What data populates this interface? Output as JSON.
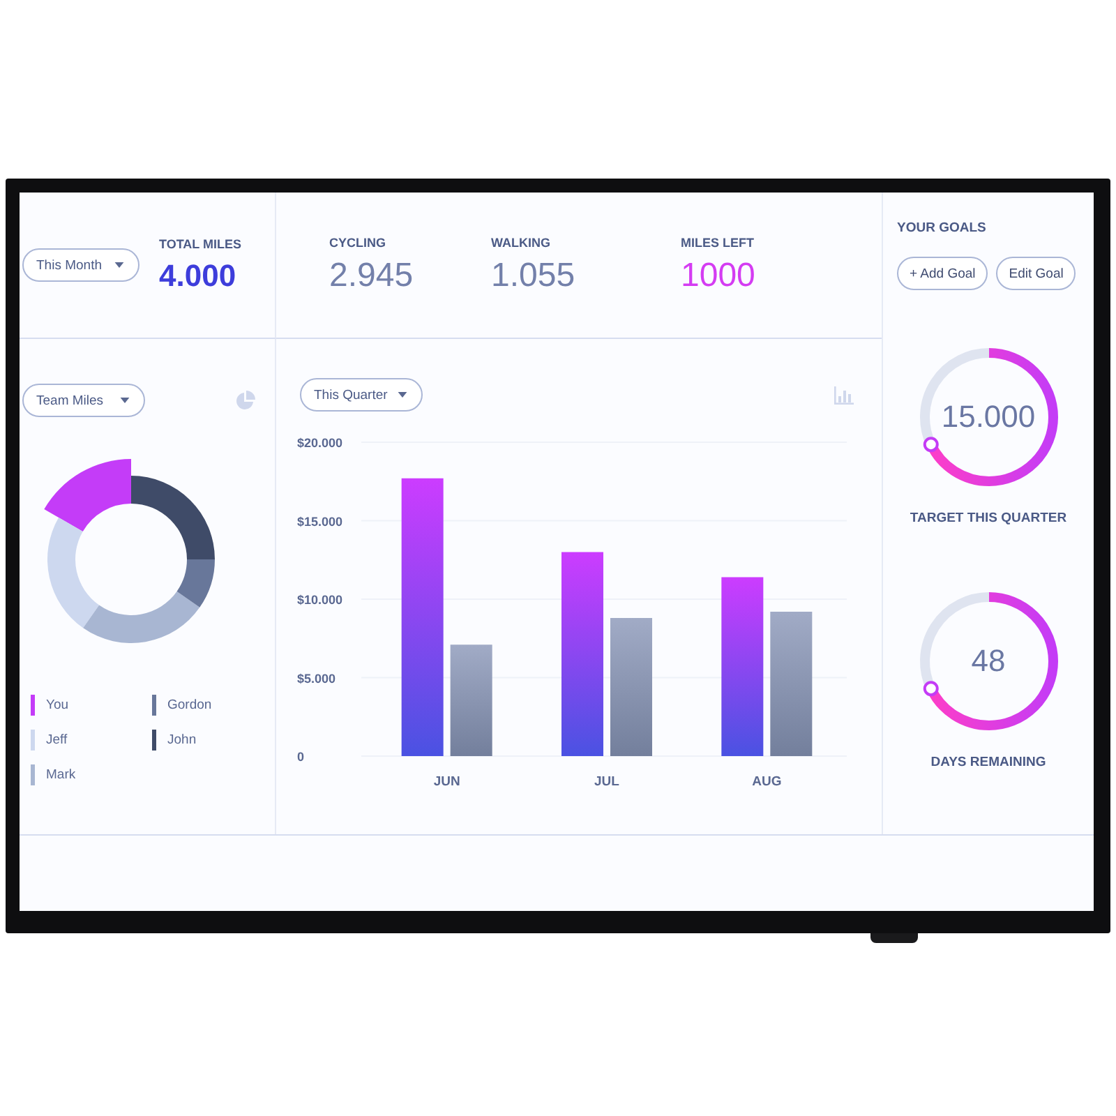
{
  "summary": {
    "period": {
      "value": "This Month"
    },
    "total": {
      "label": "TOTAL MILES",
      "value": "4.000"
    }
  },
  "stats": [
    {
      "label": "CYCLING",
      "value": "2.945",
      "kind": "plain"
    },
    {
      "label": "WALKING",
      "value": "1.055",
      "kind": "plain"
    },
    {
      "label": "MILES LEFT",
      "value": "1000",
      "kind": "accent"
    }
  ],
  "team": {
    "dropdown": {
      "value": "Team Miles"
    },
    "legend": [
      {
        "name": "You",
        "color": "#c43cf8",
        "highlighted": true
      },
      {
        "name": "Jeff",
        "color": "#cdd8ef",
        "highlighted": false
      },
      {
        "name": "Mark",
        "color": "#a8b6d2",
        "highlighted": false
      },
      {
        "name": "Gordon",
        "color": "#68779a",
        "highlighted": false
      },
      {
        "name": "John",
        "color": "#3f4b68",
        "highlighted": false
      }
    ]
  },
  "quarter": {
    "dropdown": {
      "value": "This Quarter"
    },
    "chart_data": {
      "type": "bar",
      "categories": [
        "JUN",
        "JUL",
        "AUG"
      ],
      "series": [
        {
          "color": "#cc3cff",
          "values": [
            17700,
            13000,
            11400
          ]
        },
        {
          "color": "#a1abc6",
          "values": [
            7100,
            8800,
            9200
          ]
        }
      ],
      "ylim": [
        0,
        20000
      ],
      "yticks": [
        {
          "value": 0,
          "label": "0"
        },
        {
          "value": 5000,
          "label": "$5.000"
        },
        {
          "value": 10000,
          "label": "$10.000"
        },
        {
          "value": 15000,
          "label": "$15.000"
        },
        {
          "value": 20000,
          "label": "$20.000"
        }
      ],
      "grid": true
    }
  },
  "goals": {
    "title": "YOUR GOALS",
    "buttons": [
      "+ Add Goal",
      "Edit Goal"
    ],
    "rings": [
      {
        "value": "15.000",
        "label": "TARGET THIS QUARTER",
        "level": 0.68
      },
      {
        "value": "48",
        "label": "DAYS REMAINING",
        "level": 0.68
      }
    ]
  }
}
